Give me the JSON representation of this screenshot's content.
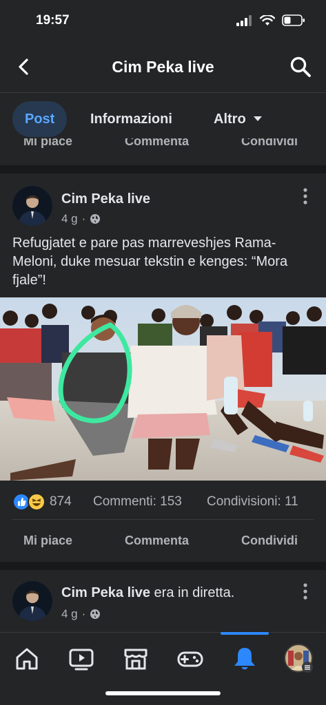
{
  "status_bar": {
    "time": "19:57",
    "icons": [
      "signal-icon",
      "wifi-icon",
      "battery-icon"
    ]
  },
  "header": {
    "title": "Cim Peka live",
    "back_icon": "chevron-left-icon",
    "search_icon": "search-icon"
  },
  "tabs": [
    {
      "label": "Post",
      "active": true
    },
    {
      "label": "Informazioni",
      "active": false
    },
    {
      "label": "Altro",
      "active": false
    }
  ],
  "previous_post_actions": {
    "like": "Mi piace",
    "comment": "Commenta",
    "share": "Condividi"
  },
  "post": {
    "author": "Cim Peka live",
    "time": "4 g",
    "separator": "·",
    "privacy_icon": "globe-icon",
    "text": "Refugjatet e pare pas marreveshjes Rama-Meloni, duke mesuar tekstin e kenges: “Mora fjale”!",
    "photo_alt": "group photo with green circle annotation",
    "reactions_count": "874",
    "reaction_icons": [
      "like-reaction-icon",
      "haha-reaction-icon"
    ],
    "comments": "Commenti: 153",
    "shares": "Condivisioni: 11",
    "actions": {
      "like": "Mi piace",
      "comment": "Commenta",
      "share": "Condividi"
    }
  },
  "next_post": {
    "author": "Cim Peka live",
    "suffix": "era in diretta.",
    "time": "4 g",
    "separator": "·",
    "privacy_icon": "globe-icon"
  },
  "bottom_nav": [
    {
      "name": "home",
      "icon": "home-icon"
    },
    {
      "name": "video",
      "icon": "video-icon"
    },
    {
      "name": "marketplace",
      "icon": "marketplace-icon"
    },
    {
      "name": "gaming",
      "icon": "gamepad-icon"
    },
    {
      "name": "notifications",
      "icon": "bell-icon",
      "active": true
    },
    {
      "name": "profile",
      "icon": "profile-avatar-icon"
    }
  ],
  "colors": {
    "background": "#242526",
    "separator": "#18191a",
    "accent": "#2d88ff",
    "active_tab_bg": "#263951",
    "text_primary": "#e4e6eb",
    "text_secondary": "#b0b3b8",
    "annotation": "#3ee8a0"
  }
}
